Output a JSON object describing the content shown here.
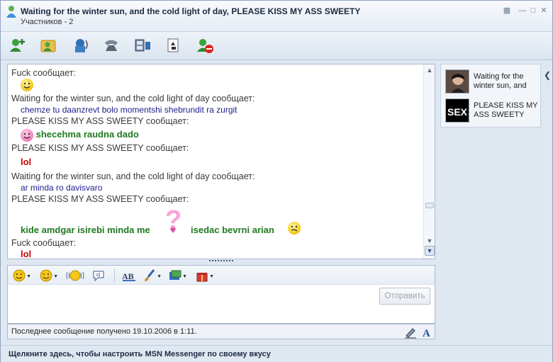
{
  "window": {
    "title": "Waiting for the winter sun, and the cold light of day, PLEASE KISS MY ASS SWEETY",
    "participants_label": "Участников - 2",
    "controls": [
      "minimize-icon",
      "maximize-icon",
      "close-icon"
    ]
  },
  "toolbar": {
    "buttons": [
      {
        "name": "invite-contact",
        "icon": "add-user-icon"
      },
      {
        "name": "send-files",
        "icon": "folder-user-icon"
      },
      {
        "name": "voice",
        "icon": "speaker-icon"
      },
      {
        "name": "call",
        "icon": "phone-icon"
      },
      {
        "name": "video",
        "icon": "video-icon"
      },
      {
        "name": "games",
        "icon": "games-icon"
      },
      {
        "name": "block",
        "icon": "block-user-icon"
      }
    ]
  },
  "conversation": {
    "messages": [
      {
        "sender": "Fuck сообщает:",
        "text": "",
        "style": "plain",
        "emoticon": "smile"
      },
      {
        "sender": "Waiting for the winter sun, and the cold light of day сообщает:",
        "text": "chemze tu daanzrevt bolo momentshi shebrundit ra zurgit",
        "style": "blue"
      },
      {
        "sender": "PLEASE KISS MY ASS SWEETY сообщает:",
        "text": "shecehma raudna dado",
        "style": "green",
        "emoticon": "pink-smile"
      },
      {
        "sender": "PLEASE KISS MY ASS SWEETY сообщает:",
        "text": "lol",
        "style": "red"
      },
      {
        "sender": "Waiting for the winter sun, and the cold light of day сообщает:",
        "text": "ar minda ro davisvaro",
        "style": "blue"
      },
      {
        "sender": "PLEASE KISS MY ASS SWEETY сообщает:",
        "text": "kide amdgar isirebi minda me",
        "text2": "isedac bevrni arian",
        "style": "green",
        "emoticon": "question-mark-pink",
        "emoticon2": "confused"
      },
      {
        "sender": "Fuck сообщает:",
        "text": "lol",
        "style": "red"
      }
    ]
  },
  "format_toolbar": {
    "buttons": [
      {
        "name": "emoticons",
        "icon": "smiley-icon"
      },
      {
        "name": "winks",
        "icon": "wink-icon"
      },
      {
        "name": "nudge",
        "icon": "nudge-icon"
      },
      {
        "name": "voice-clip",
        "icon": "voice-clip-icon"
      },
      {
        "name": "font",
        "icon": "font-icon"
      },
      {
        "name": "handwriting",
        "icon": "brush-icon"
      },
      {
        "name": "background",
        "icon": "background-icon"
      },
      {
        "name": "gifts",
        "icon": "gift-icon"
      }
    ]
  },
  "composer": {
    "value": "",
    "send_label": "Отправить"
  },
  "status": {
    "last_message": "Последнее сообщение получено 19.10.2006 в 1:11."
  },
  "footer": {
    "text": "Щелкните здесь, чтобы настроить MSN Messenger по своему вкусу"
  },
  "participants": [
    {
      "name": "Waiting for the winter sun, and",
      "avatar": "photo"
    },
    {
      "name": "PLEASE KISS MY ASS SWEETY",
      "avatar": "SEX"
    }
  ],
  "colors": {
    "accent": "#1f7a1f",
    "sender_text": "#3a3a3a",
    "blue_text": "#20208e",
    "red_text": "#cc0000"
  }
}
